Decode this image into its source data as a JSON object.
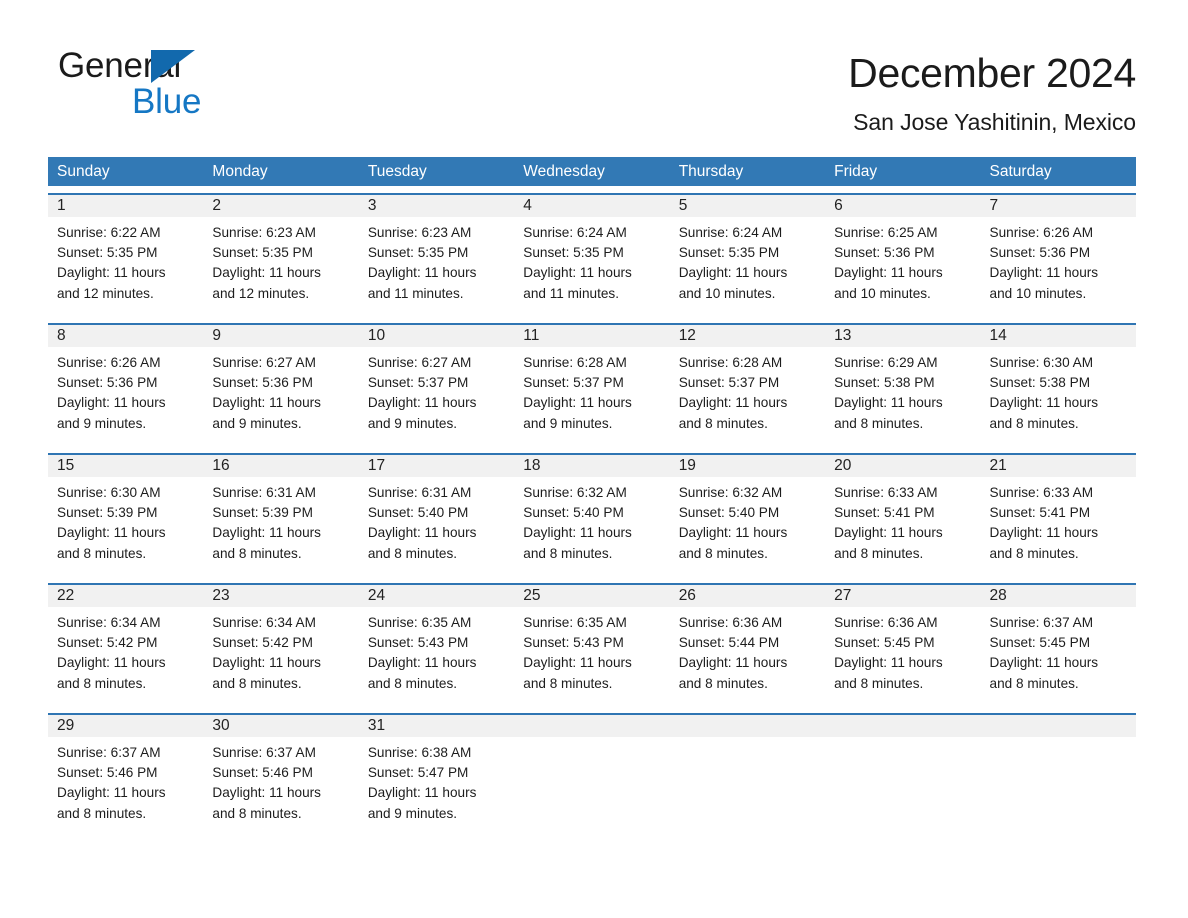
{
  "brand": {
    "name_part1": "General",
    "name_part2": "Blue",
    "triangle_icon": "triangle-icon",
    "color_black": "#1b1b1b",
    "color_blue": "#1577c4"
  },
  "header": {
    "title": "December 2024",
    "subtitle": "San Jose Yashitinin, Mexico"
  },
  "theme": {
    "header_blue": "#3279b5",
    "row_rule_blue": "#2f75b3",
    "daynum_band": "#f1f1f1",
    "text": "#1d1d1d"
  },
  "calendar": {
    "weekdays": [
      "Sunday",
      "Monday",
      "Tuesday",
      "Wednesday",
      "Thursday",
      "Friday",
      "Saturday"
    ],
    "labels": {
      "sunrise_prefix": "Sunrise:",
      "sunset_prefix": "Sunset:",
      "daylight_prefix": "Daylight:"
    },
    "weeks": [
      [
        {
          "day": "1",
          "sunrise": "Sunrise: 6:22 AM",
          "sunset": "Sunset: 5:35 PM",
          "daylight_line1": "Daylight: 11 hours",
          "daylight_line2": "and 12 minutes."
        },
        {
          "day": "2",
          "sunrise": "Sunrise: 6:23 AM",
          "sunset": "Sunset: 5:35 PM",
          "daylight_line1": "Daylight: 11 hours",
          "daylight_line2": "and 12 minutes."
        },
        {
          "day": "3",
          "sunrise": "Sunrise: 6:23 AM",
          "sunset": "Sunset: 5:35 PM",
          "daylight_line1": "Daylight: 11 hours",
          "daylight_line2": "and 11 minutes."
        },
        {
          "day": "4",
          "sunrise": "Sunrise: 6:24 AM",
          "sunset": "Sunset: 5:35 PM",
          "daylight_line1": "Daylight: 11 hours",
          "daylight_line2": "and 11 minutes."
        },
        {
          "day": "5",
          "sunrise": "Sunrise: 6:24 AM",
          "sunset": "Sunset: 5:35 PM",
          "daylight_line1": "Daylight: 11 hours",
          "daylight_line2": "and 10 minutes."
        },
        {
          "day": "6",
          "sunrise": "Sunrise: 6:25 AM",
          "sunset": "Sunset: 5:36 PM",
          "daylight_line1": "Daylight: 11 hours",
          "daylight_line2": "and 10 minutes."
        },
        {
          "day": "7",
          "sunrise": "Sunrise: 6:26 AM",
          "sunset": "Sunset: 5:36 PM",
          "daylight_line1": "Daylight: 11 hours",
          "daylight_line2": "and 10 minutes."
        }
      ],
      [
        {
          "day": "8",
          "sunrise": "Sunrise: 6:26 AM",
          "sunset": "Sunset: 5:36 PM",
          "daylight_line1": "Daylight: 11 hours",
          "daylight_line2": "and 9 minutes."
        },
        {
          "day": "9",
          "sunrise": "Sunrise: 6:27 AM",
          "sunset": "Sunset: 5:36 PM",
          "daylight_line1": "Daylight: 11 hours",
          "daylight_line2": "and 9 minutes."
        },
        {
          "day": "10",
          "sunrise": "Sunrise: 6:27 AM",
          "sunset": "Sunset: 5:37 PM",
          "daylight_line1": "Daylight: 11 hours",
          "daylight_line2": "and 9 minutes."
        },
        {
          "day": "11",
          "sunrise": "Sunrise: 6:28 AM",
          "sunset": "Sunset: 5:37 PM",
          "daylight_line1": "Daylight: 11 hours",
          "daylight_line2": "and 9 minutes."
        },
        {
          "day": "12",
          "sunrise": "Sunrise: 6:28 AM",
          "sunset": "Sunset: 5:37 PM",
          "daylight_line1": "Daylight: 11 hours",
          "daylight_line2": "and 8 minutes."
        },
        {
          "day": "13",
          "sunrise": "Sunrise: 6:29 AM",
          "sunset": "Sunset: 5:38 PM",
          "daylight_line1": "Daylight: 11 hours",
          "daylight_line2": "and 8 minutes."
        },
        {
          "day": "14",
          "sunrise": "Sunrise: 6:30 AM",
          "sunset": "Sunset: 5:38 PM",
          "daylight_line1": "Daylight: 11 hours",
          "daylight_line2": "and 8 minutes."
        }
      ],
      [
        {
          "day": "15",
          "sunrise": "Sunrise: 6:30 AM",
          "sunset": "Sunset: 5:39 PM",
          "daylight_line1": "Daylight: 11 hours",
          "daylight_line2": "and 8 minutes."
        },
        {
          "day": "16",
          "sunrise": "Sunrise: 6:31 AM",
          "sunset": "Sunset: 5:39 PM",
          "daylight_line1": "Daylight: 11 hours",
          "daylight_line2": "and 8 minutes."
        },
        {
          "day": "17",
          "sunrise": "Sunrise: 6:31 AM",
          "sunset": "Sunset: 5:40 PM",
          "daylight_line1": "Daylight: 11 hours",
          "daylight_line2": "and 8 minutes."
        },
        {
          "day": "18",
          "sunrise": "Sunrise: 6:32 AM",
          "sunset": "Sunset: 5:40 PM",
          "daylight_line1": "Daylight: 11 hours",
          "daylight_line2": "and 8 minutes."
        },
        {
          "day": "19",
          "sunrise": "Sunrise: 6:32 AM",
          "sunset": "Sunset: 5:40 PM",
          "daylight_line1": "Daylight: 11 hours",
          "daylight_line2": "and 8 minutes."
        },
        {
          "day": "20",
          "sunrise": "Sunrise: 6:33 AM",
          "sunset": "Sunset: 5:41 PM",
          "daylight_line1": "Daylight: 11 hours",
          "daylight_line2": "and 8 minutes."
        },
        {
          "day": "21",
          "sunrise": "Sunrise: 6:33 AM",
          "sunset": "Sunset: 5:41 PM",
          "daylight_line1": "Daylight: 11 hours",
          "daylight_line2": "and 8 minutes."
        }
      ],
      [
        {
          "day": "22",
          "sunrise": "Sunrise: 6:34 AM",
          "sunset": "Sunset: 5:42 PM",
          "daylight_line1": "Daylight: 11 hours",
          "daylight_line2": "and 8 minutes."
        },
        {
          "day": "23",
          "sunrise": "Sunrise: 6:34 AM",
          "sunset": "Sunset: 5:42 PM",
          "daylight_line1": "Daylight: 11 hours",
          "daylight_line2": "and 8 minutes."
        },
        {
          "day": "24",
          "sunrise": "Sunrise: 6:35 AM",
          "sunset": "Sunset: 5:43 PM",
          "daylight_line1": "Daylight: 11 hours",
          "daylight_line2": "and 8 minutes."
        },
        {
          "day": "25",
          "sunrise": "Sunrise: 6:35 AM",
          "sunset": "Sunset: 5:43 PM",
          "daylight_line1": "Daylight: 11 hours",
          "daylight_line2": "and 8 minutes."
        },
        {
          "day": "26",
          "sunrise": "Sunrise: 6:36 AM",
          "sunset": "Sunset: 5:44 PM",
          "daylight_line1": "Daylight: 11 hours",
          "daylight_line2": "and 8 minutes."
        },
        {
          "day": "27",
          "sunrise": "Sunrise: 6:36 AM",
          "sunset": "Sunset: 5:45 PM",
          "daylight_line1": "Daylight: 11 hours",
          "daylight_line2": "and 8 minutes."
        },
        {
          "day": "28",
          "sunrise": "Sunrise: 6:37 AM",
          "sunset": "Sunset: 5:45 PM",
          "daylight_line1": "Daylight: 11 hours",
          "daylight_line2": "and 8 minutes."
        }
      ],
      [
        {
          "day": "29",
          "sunrise": "Sunrise: 6:37 AM",
          "sunset": "Sunset: 5:46 PM",
          "daylight_line1": "Daylight: 11 hours",
          "daylight_line2": "and 8 minutes."
        },
        {
          "day": "30",
          "sunrise": "Sunrise: 6:37 AM",
          "sunset": "Sunset: 5:46 PM",
          "daylight_line1": "Daylight: 11 hours",
          "daylight_line2": "and 8 minutes."
        },
        {
          "day": "31",
          "sunrise": "Sunrise: 6:38 AM",
          "sunset": "Sunset: 5:47 PM",
          "daylight_line1": "Daylight: 11 hours",
          "daylight_line2": "and 9 minutes."
        },
        {
          "day": "",
          "sunrise": "",
          "sunset": "",
          "daylight_line1": "",
          "daylight_line2": ""
        },
        {
          "day": "",
          "sunrise": "",
          "sunset": "",
          "daylight_line1": "",
          "daylight_line2": ""
        },
        {
          "day": "",
          "sunrise": "",
          "sunset": "",
          "daylight_line1": "",
          "daylight_line2": ""
        },
        {
          "day": "",
          "sunrise": "",
          "sunset": "",
          "daylight_line1": "",
          "daylight_line2": ""
        }
      ]
    ]
  }
}
